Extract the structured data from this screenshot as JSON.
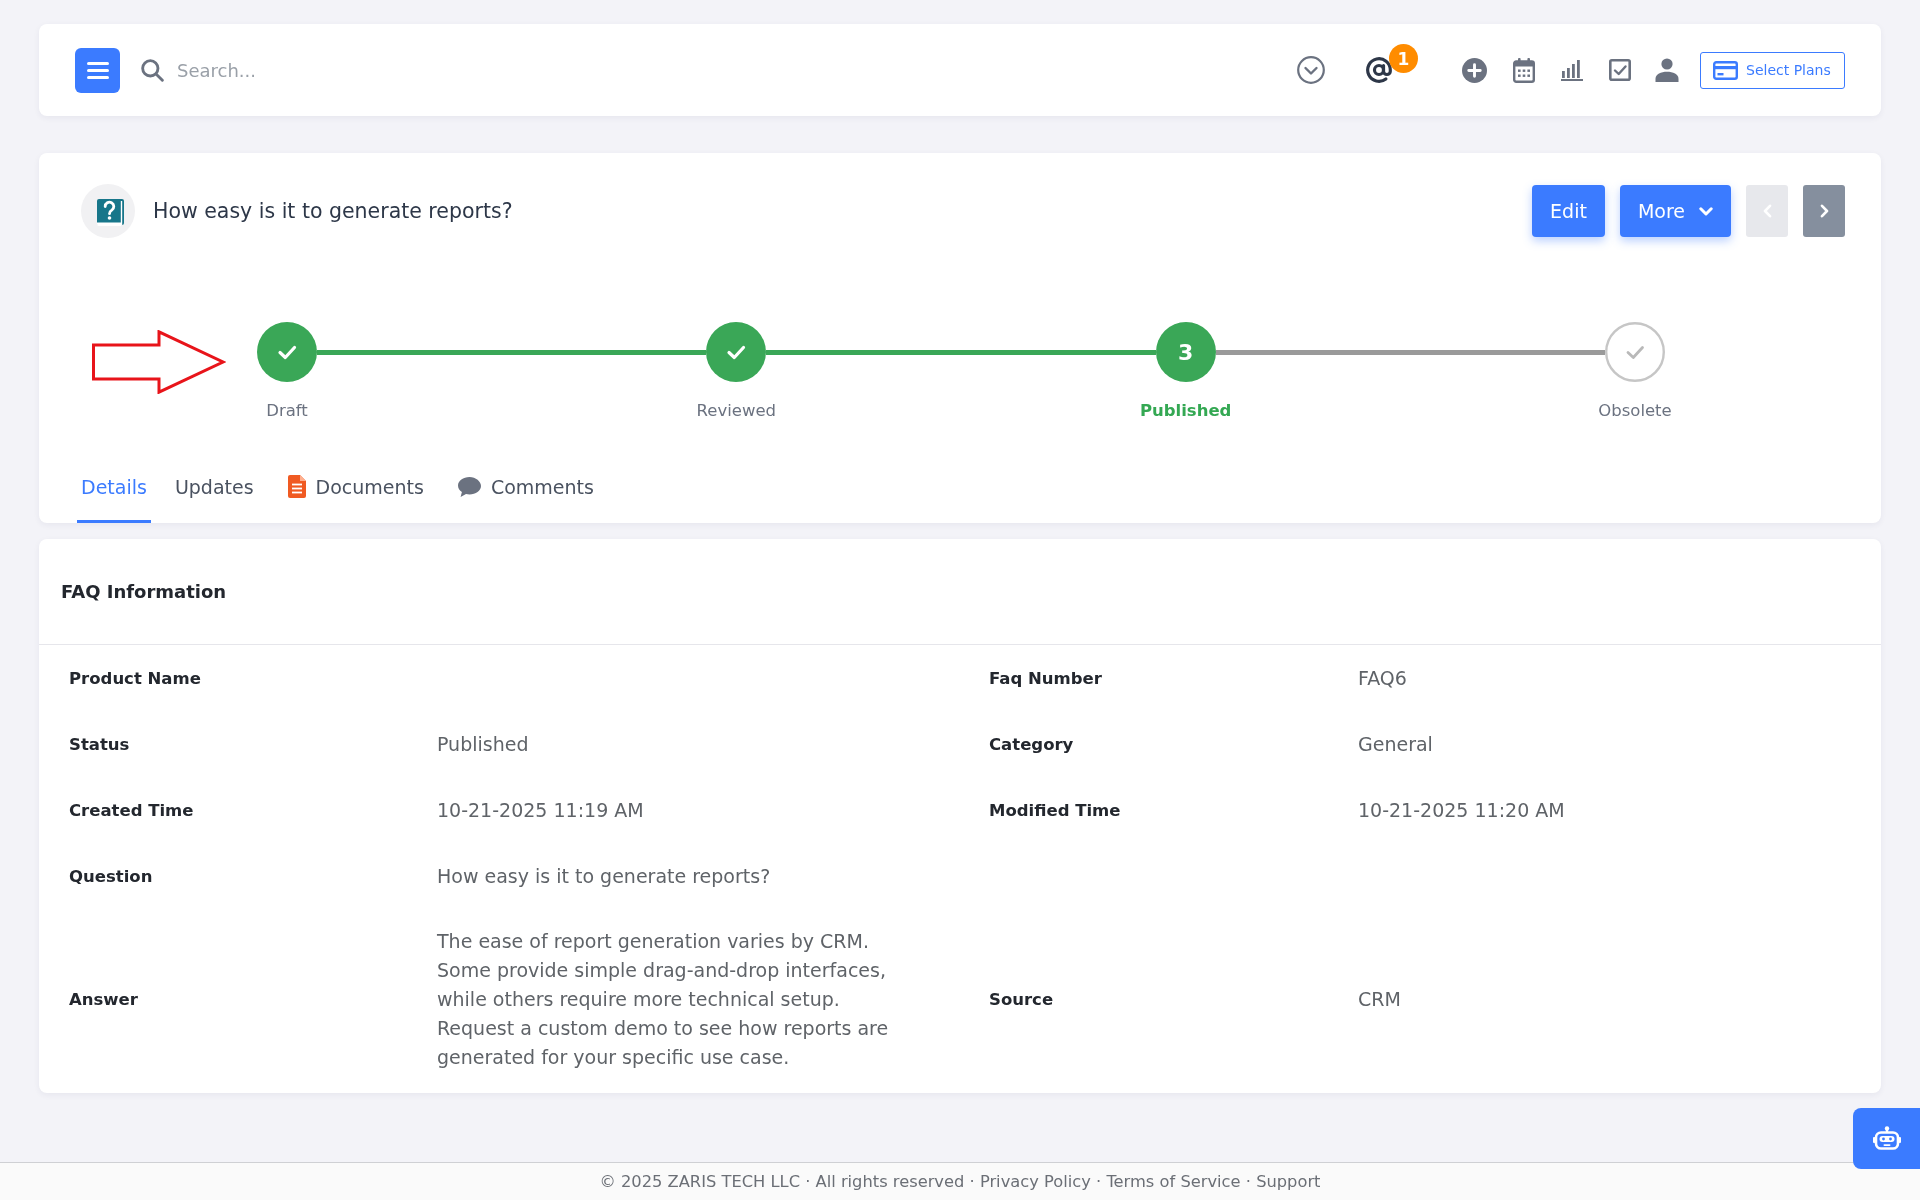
{
  "top_bar": {
    "search": {
      "placeholder": "Search..."
    },
    "mentions_count": "1",
    "plans_button": "Select Plans"
  },
  "record": {
    "title": "How easy is it to generate reports?",
    "edit_button": "Edit",
    "more_button": "More",
    "pager": {
      "previous": {
        "disabled": true
      },
      "next": {
        "disabled": false
      }
    },
    "stages": [
      {
        "label": "Draft",
        "completed": true,
        "current": false
      },
      {
        "label": "Reviewed",
        "completed": true,
        "current": false
      },
      {
        "label": "Published",
        "completed": false,
        "current": true,
        "number": "3"
      },
      {
        "label": "Obsolete",
        "completed": false,
        "current": false
      }
    ],
    "tabs": [
      {
        "label": "Details",
        "selected": true
      },
      {
        "label": "Updates",
        "selected": false
      },
      {
        "label": "Documents",
        "selected": false
      },
      {
        "label": "Comments",
        "selected": false
      }
    ]
  },
  "faq_information": {
    "title": "FAQ Information",
    "rows": [
      {
        "left": {
          "label": "Product Name"
        },
        "right": {
          "label": "Faq Number",
          "value": "FAQ6"
        }
      },
      {
        "left": {
          "label": "Status",
          "value": "Published"
        },
        "right": {
          "label": "Category",
          "value": "General"
        }
      },
      {
        "left": {
          "label": "Created Time",
          "value": "10-21-2025 11:19 AM"
        },
        "right": {
          "label": "Modified Time",
          "value": "10-21-2025 11:20 AM"
        }
      },
      {
        "left": {
          "label": "Question",
          "value": "How easy is it to generate reports?"
        }
      },
      {
        "left": {
          "label": "Answer",
          "value": "The ease of report generation varies by CRM. Some provide simple drag-and-drop interfaces, while others require more technical setup. Request a custom demo to see how reports are generated for your specific use case."
        },
        "right": {
          "label": "Source",
          "value": "CRM"
        }
      }
    ]
  },
  "footer": {
    "notice": "© 2025 ZARIS TECH LLC · All rights reserved ·",
    "links": [
      {
        "label": "Privacy Policy"
      },
      {
        "separator": "·",
        "label": "Terms of Service"
      },
      {
        "separator": "·",
        "label": "Support"
      }
    ]
  }
}
